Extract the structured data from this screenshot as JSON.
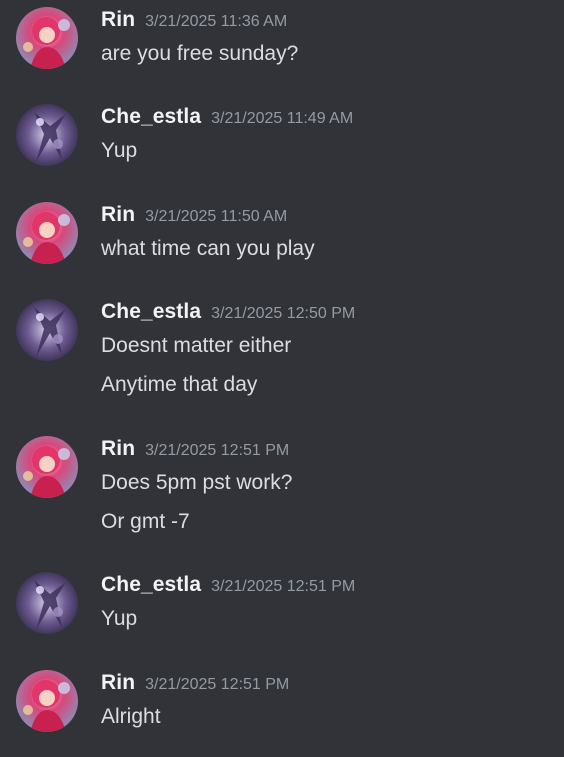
{
  "colors": {
    "background": "#313338",
    "author": "#f2f3f5",
    "timestamp": "#949ba4",
    "text": "#dbdee1"
  },
  "messages": [
    {
      "author": "Rin",
      "avatar": "rin-avatar",
      "timestamp": "3/21/2025 11:36 AM",
      "lines": [
        "are you free sunday?"
      ]
    },
    {
      "author": "Che_estla",
      "avatar": "che-avatar",
      "timestamp": "3/21/2025 11:49 AM",
      "lines": [
        "Yup"
      ]
    },
    {
      "author": "Rin",
      "avatar": "rin-avatar",
      "timestamp": "3/21/2025 11:50 AM",
      "lines": [
        "what time can you play"
      ]
    },
    {
      "author": "Che_estla",
      "avatar": "che-avatar",
      "timestamp": "3/21/2025 12:50 PM",
      "lines": [
        "Doesnt matter either",
        "Anytime that day"
      ]
    },
    {
      "author": "Rin",
      "avatar": "rin-avatar",
      "timestamp": "3/21/2025 12:51 PM",
      "lines": [
        "Does 5pm pst work?",
        "Or gmt -7"
      ]
    },
    {
      "author": "Che_estla",
      "avatar": "che-avatar",
      "timestamp": "3/21/2025 12:51 PM",
      "lines": [
        "Yup"
      ]
    },
    {
      "author": "Rin",
      "avatar": "rin-avatar",
      "timestamp": "3/21/2025 12:51 PM",
      "lines": [
        "Alright"
      ]
    }
  ]
}
